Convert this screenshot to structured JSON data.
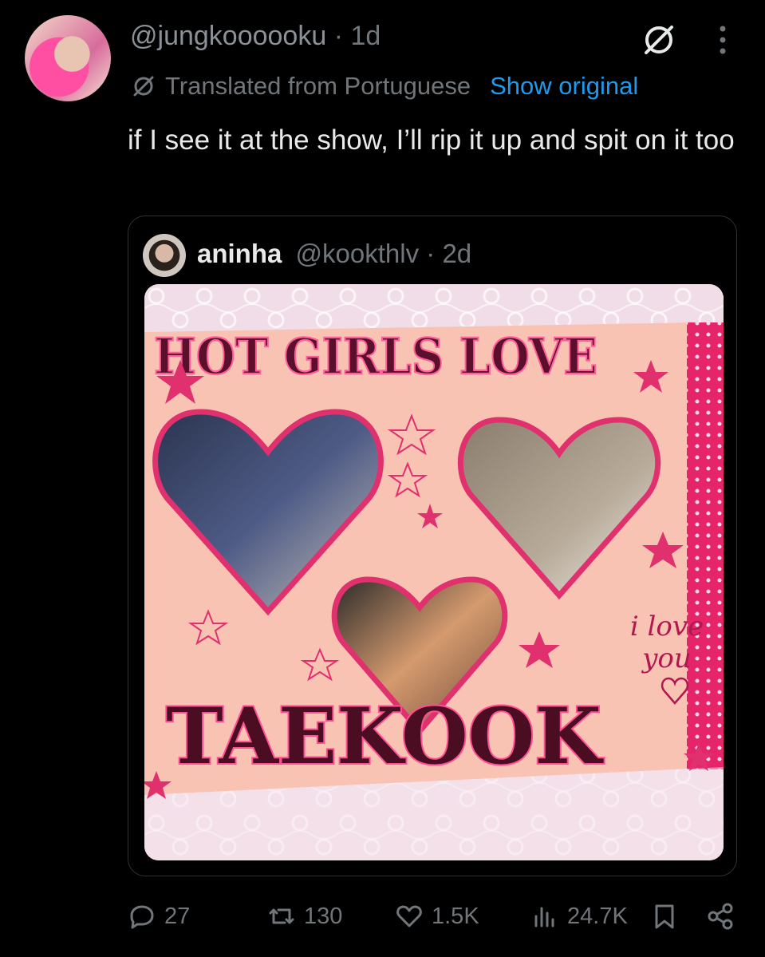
{
  "tweet": {
    "handle": "@jungkoooooku",
    "separator": "·",
    "time": "1d",
    "translate_label": "Translated from Portuguese",
    "show_original_label": "Show original",
    "text": "if I see it at the show, I’ll rip it up and spit on it too"
  },
  "quote": {
    "name": "aninha",
    "handle": "@kookthlv",
    "separator": "·",
    "time": "2d",
    "media": {
      "banner_title": "HOT GIRLS LOVE",
      "banner_name": "TAEKOOK",
      "handwriting_line1": "i love",
      "handwriting_line2": "you"
    }
  },
  "actions": {
    "replies": "27",
    "reposts": "130",
    "likes": "1.5K",
    "views": "24.7K"
  },
  "colors": {
    "background": "#000000",
    "text_primary": "#e7e9ea",
    "text_secondary": "#71767b",
    "link": "#1d9bf0",
    "border": "#2f3336"
  },
  "icons": {
    "grok": "grok-icon",
    "more": "more-icon",
    "translate": "translate-icon",
    "reply": "reply-icon",
    "repost": "repost-icon",
    "like": "heart-icon",
    "views": "views-icon",
    "bookmark": "bookmark-icon",
    "share": "share-icon"
  }
}
